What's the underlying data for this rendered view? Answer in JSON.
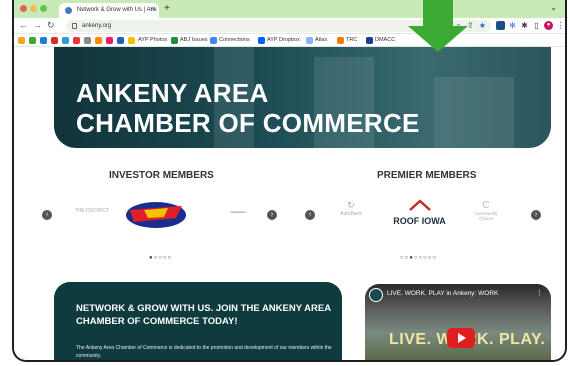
{
  "browser": {
    "tab_title": "Network & Grow with Us | Ank",
    "tab_close": "×",
    "new_tab": "+",
    "url": "ankeny.org",
    "bookmarks": [
      "AYP Photos",
      "ABJ Issues",
      "Connections",
      "AYP Dropbox",
      "Atlas",
      "TRC",
      "DMACC"
    ]
  },
  "hero": {
    "title_line1": "ANKENY AREA",
    "title_line2": "CHAMBER OF COMMERCE"
  },
  "investor": {
    "heading": "INVESTOR MEMBERS",
    "logo_left": "THE DISTRICT",
    "pager": "●○○○○"
  },
  "premier": {
    "heading": "PREMIER MEMBERS",
    "logo_left": "AutoBank",
    "logo_main": "ROOF IOWA",
    "logo_right": "Community Choice",
    "pager": "○○●○○○○○"
  },
  "cta": {
    "heading": "NETWORK & GROW WITH US. JOIN THE ANKENY AREA CHAMBER OF COMMERCE TODAY!",
    "body": "The Ankeny Area Chamber of Commerce is dedicated to the promotion and development of our members within the community."
  },
  "video": {
    "title": "LIVE. WORK. PLAY in Ankeny: WORK",
    "overlay": "LIVE. WORK. PLAY."
  },
  "colors": {
    "tabbar": "#c8eab6",
    "hero": "#1b4a52",
    "cta": "#0f3b3f",
    "arrow": "#3aaa35",
    "youtube": "#e21d1d"
  }
}
